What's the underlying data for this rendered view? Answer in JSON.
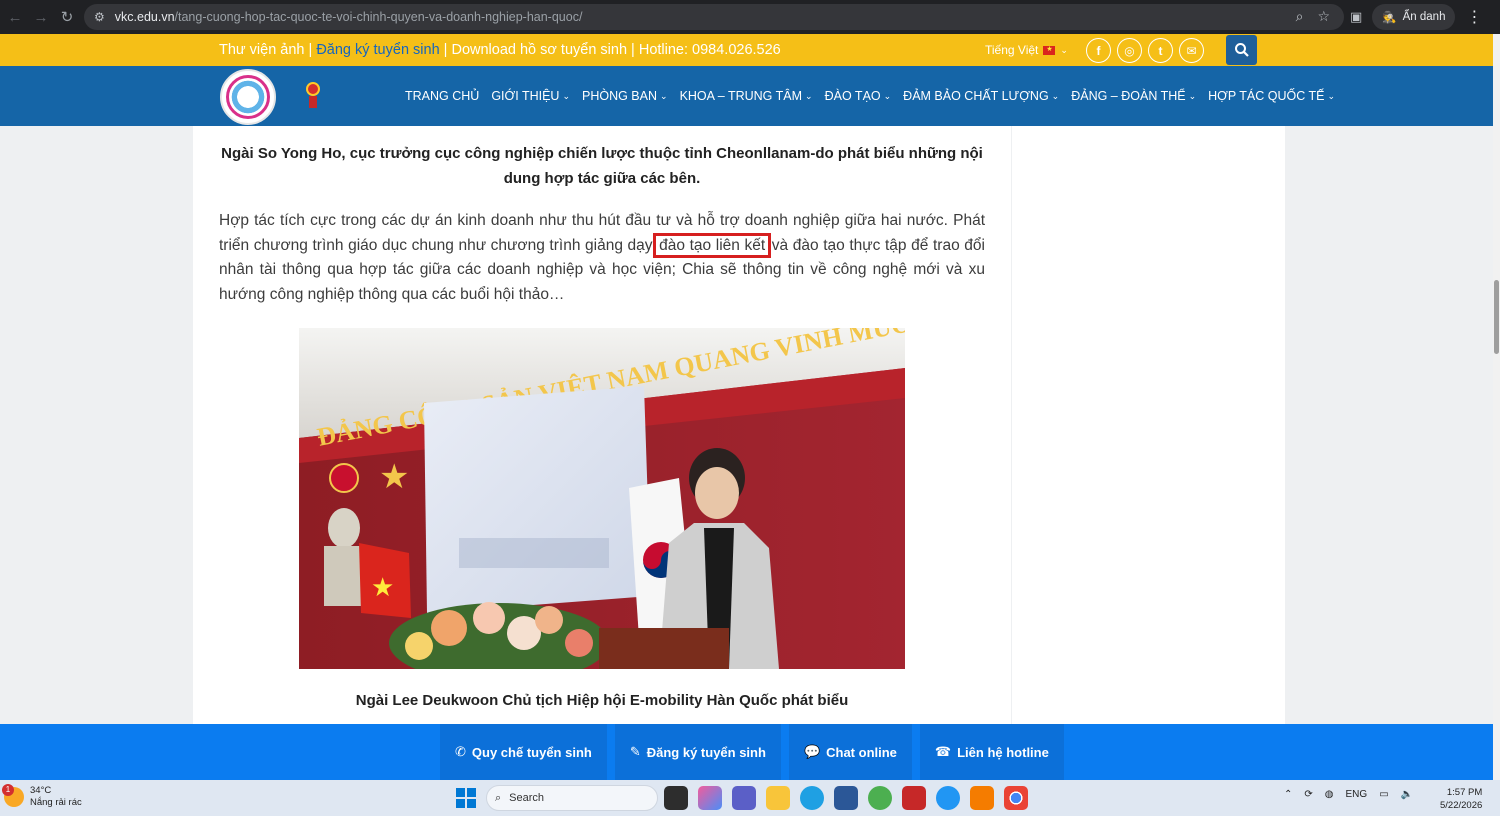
{
  "browser": {
    "url_host": "vkc.edu.vn",
    "url_path": "/tang-cuong-hop-tac-quoc-te-voi-chinh-quyen-va-doanh-nghiep-han-quoc/",
    "incognito_label": "Ẩn danh"
  },
  "topbar": {
    "link1": "Thư viện ảnh",
    "sep1": " | ",
    "link2": "Đăng ký tuyển sinh",
    "sep2": " | ",
    "link3": "Download hồ sơ tuyển sinh",
    "sep3": " | ",
    "hotline": "Hotline: 0984.026.526",
    "language": "Tiếng Việt",
    "socials": [
      "f",
      "◎",
      "t",
      "✉"
    ]
  },
  "nav": {
    "items": [
      "TRANG CHỦ",
      "GIỚI THIỆU",
      "PHÒNG BAN",
      "KHOA – TRUNG TÂM",
      "ĐÀO TẠO",
      "ĐẢM BẢO CHẤT LƯỢNG",
      "ĐẢNG – ĐOÀN THỂ",
      "HỢP TÁC QUỐC TẾ"
    ]
  },
  "article": {
    "caption1": "Ngài So Yong Ho, cục trưởng cục công nghiệp chiến lược thuộc tỉnh Cheonllanam-do phát biểu những nội dung hợp tác giữa các bên.",
    "para_before": "Hợp tác tích cực trong các dự án kinh doanh như thu hút đầu tư và hỗ trợ doanh nghiệp giữa hai nước. Phát triển chương trình giáo dục chung như chương trình giảng dạy ",
    "para_link": "đào tạo liên kết",
    "para_after": " và đào tạo thực tập để trao đổi nhân tài thông qua hợp tác giữa các doanh nghiệp và học viện; Chia sẽ thông tin về công nghệ mới và xu hướng công nghiệp thông qua các buổi hội thảo…",
    "photo_banner": "ĐẢNG CỘNG SẢN VIỆT NAM QUANG VINH MUÔN NĂM",
    "caption2": "Ngài Lee Deukwoon Chủ tịch Hiệp hội E-mobility Hàn Quốc phát biểu"
  },
  "bottombar": {
    "items": [
      "Quy chế tuyển sinh",
      "Đăng ký tuyển sinh",
      "Chat online",
      "Liên hệ hotline"
    ]
  },
  "taskbar": {
    "weather_badge": "1",
    "temperature": "34°C",
    "weather_desc": "Nắng rải rác",
    "search_label": "Search",
    "lang": "ENG",
    "time": "1:57 PM",
    "date": "5/22/2026"
  }
}
